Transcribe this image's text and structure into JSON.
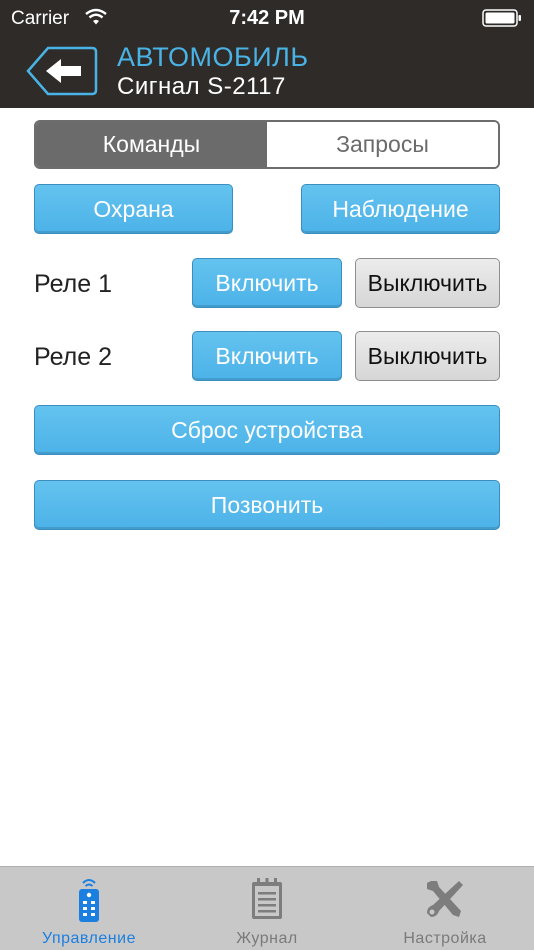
{
  "status_bar": {
    "carrier": "Carrier",
    "time": "7:42 PM"
  },
  "nav": {
    "title": "АВТОМОБИЛЬ",
    "subtitle": "Сигнал S-2117"
  },
  "segmented": {
    "items": [
      "Команды",
      "Запросы"
    ],
    "selected": "Команды"
  },
  "buttons": {
    "guard": "Охрана",
    "watch": "Наблюдение",
    "reset": "Сброс устройства",
    "call": "Позвонить"
  },
  "relays": [
    {
      "label": "Реле 1",
      "on": "Включить",
      "off": "Выключить"
    },
    {
      "label": "Реле 2",
      "on": "Включить",
      "off": "Выключить"
    }
  ],
  "tabbar": {
    "items": [
      "Управление",
      "Журнал",
      "Настройка"
    ],
    "active": "Управление"
  },
  "colors": {
    "accent": "#4ab3e6",
    "button_blue": "#56b8ea",
    "header_bg": "#2e2b29",
    "tab_active": "#1b7fe0",
    "tab_inactive": "#7a7a7a"
  },
  "icons": {
    "back": "back-arrow-icon",
    "tab_control": "remote-control-icon",
    "tab_journal": "notepad-icon",
    "tab_settings": "tools-icon"
  }
}
